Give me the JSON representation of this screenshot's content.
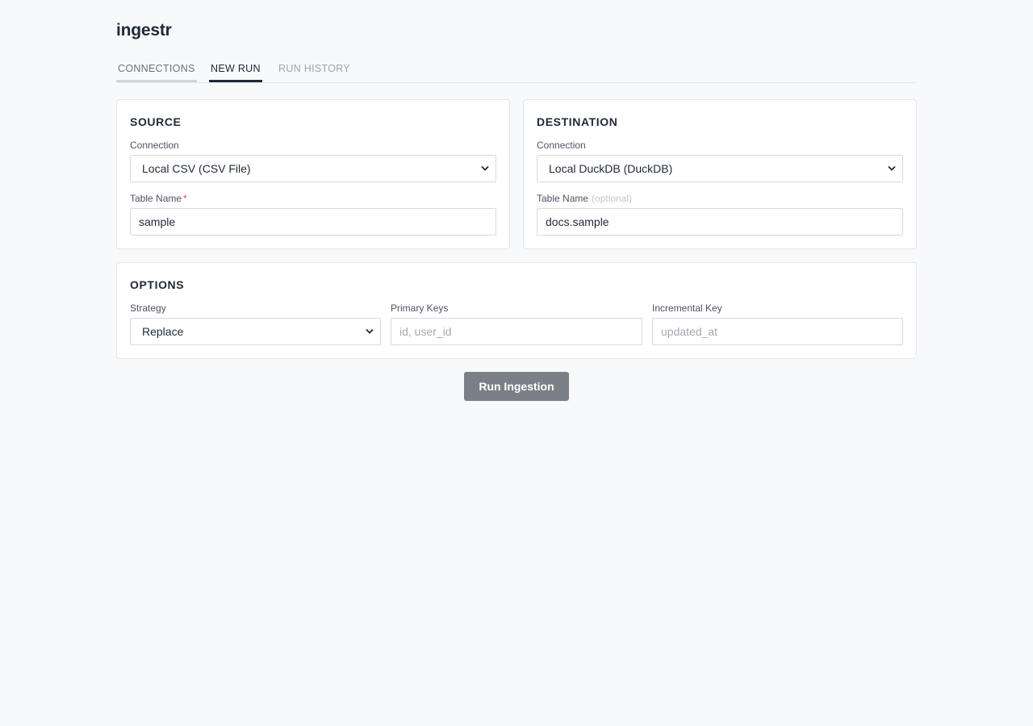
{
  "app": {
    "title": "ingestr"
  },
  "tabs": [
    {
      "label": "CONNECTIONS"
    },
    {
      "label": "NEW RUN"
    },
    {
      "label": "RUN HISTORY"
    }
  ],
  "source": {
    "title": "SOURCE",
    "connection_label": "Connection",
    "connection_value": "Local CSV (CSV File)",
    "table_label": "Table Name",
    "table_required": "*",
    "table_value": "sample"
  },
  "destination": {
    "title": "DESTINATION",
    "connection_label": "Connection",
    "connection_value": "Local DuckDB (DuckDB)",
    "table_label": "Table Name",
    "table_hint": "(optional)",
    "table_value": "docs.sample"
  },
  "options": {
    "title": "OPTIONS",
    "strategy_label": "Strategy",
    "strategy_value": "Replace",
    "primary_keys_label": "Primary Keys",
    "primary_keys_placeholder": "id, user_id",
    "incremental_key_label": "Incremental Key",
    "incremental_key_placeholder": "updated_at"
  },
  "actions": {
    "run_label": "Run Ingestion"
  },
  "colors": {
    "accent": "#1f2937",
    "button": "#7b7f86",
    "required": "#ef4444",
    "background": "#f8f9fb"
  }
}
